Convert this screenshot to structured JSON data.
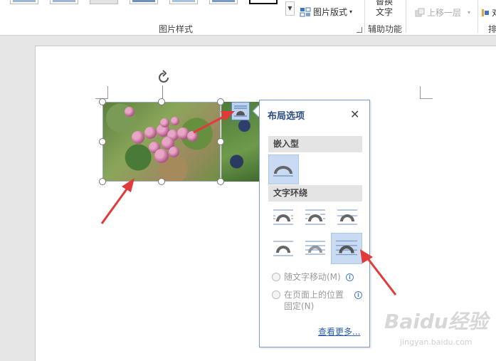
{
  "ribbon": {
    "picture_layout_label": "图片版式",
    "alt_text_line1": "替换",
    "alt_text_line2": "文字",
    "bring_forward_label": "上移一层",
    "group_picture_styles": "图片样式",
    "group_accessibility": "辅助功能",
    "partial_right_text": "对",
    "partial_right_group": "排"
  },
  "layout_panel": {
    "title": "布局选项",
    "close_glyph": "✕",
    "section_inline": "嵌入型",
    "section_wrap": "文字环绕",
    "option_move_with_text": "随文字移动(M)",
    "option_fix_position_line1": "在页面上的位置",
    "option_fix_position_line2": "固定(N)",
    "info_glyph": "i",
    "see_more": "查看更多..."
  },
  "watermark": {
    "brand": "Baidu经验",
    "url": "jingyan.baidu.com"
  },
  "colors": {
    "accent": "#2b5fa8",
    "selected_bg": "#c9dbf2",
    "arrow": "#e23a3a"
  }
}
